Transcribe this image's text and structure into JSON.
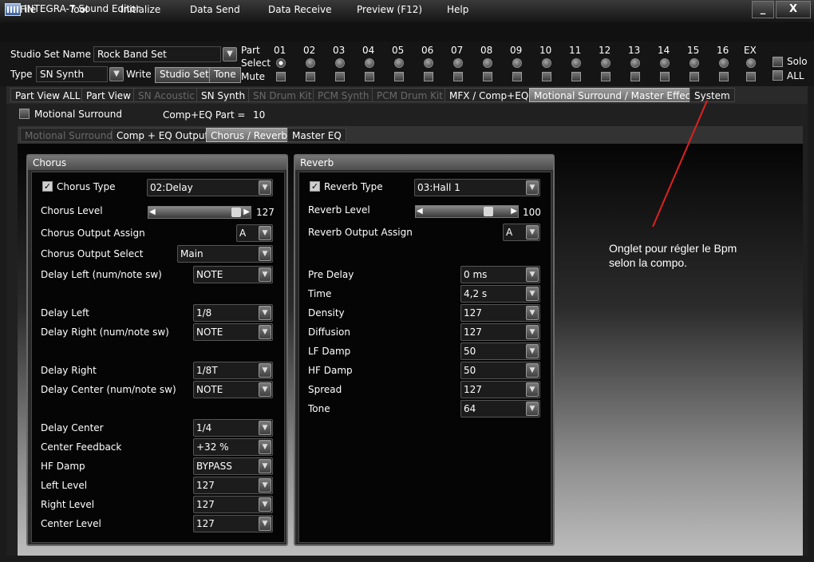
{
  "window": {
    "title": "INTEGRA-7 Sound Editor",
    "min": "_",
    "close": "X"
  },
  "menu": [
    "File",
    "Tool",
    "Initialize",
    "Data Send",
    "Data Receive",
    "Preview (F12)",
    "Help"
  ],
  "topbar": {
    "studio_set_label": "Studio Set Name",
    "studio_set_value": "Rock Band Set",
    "type_label": "Type",
    "type_value": "SN Synth",
    "write_label": "Write",
    "studio_set_btn": "Studio Set",
    "tone_btn": "Tone",
    "part_label": "Part",
    "select_label": "Select",
    "mute_label": "Mute",
    "parts": [
      "01",
      "02",
      "03",
      "04",
      "05",
      "06",
      "07",
      "08",
      "09",
      "10",
      "11",
      "12",
      "13",
      "14",
      "15",
      "16",
      "EX"
    ],
    "selected_part": "01",
    "solo_label": "Solo",
    "all_label": "ALL"
  },
  "tabs": [
    "Part View ALL",
    "Part View",
    "SN Acoustic",
    "SN Synth",
    "SN Drum Kit",
    "PCM Synth",
    "PCM Drum Kit",
    "MFX / Comp+EQ",
    "Motional Surround / Master Effects",
    "System"
  ],
  "motional": {
    "label": "Motional Surround",
    "comp_eq_label": "Comp+EQ Part =",
    "comp_eq_value": "10"
  },
  "subtabs": [
    "Motional Surround",
    "Comp + EQ Output",
    "Chorus / Reverb",
    "Master EQ"
  ],
  "chorus": {
    "title": "Chorus",
    "type_label": "Chorus Type",
    "type_value": "02:Delay",
    "level_label": "Chorus Level",
    "level_value": "127",
    "level_fraction": 1.0,
    "output_assign_label": "Chorus Output Assign",
    "output_assign_value": "A",
    "output_select_label": "Chorus Output Select",
    "output_select_value": "Main",
    "params": [
      {
        "label": "Delay Left (num/note sw)",
        "value": "NOTE"
      },
      {
        "label": "Delay Left",
        "value": "1/8"
      },
      {
        "label": "Delay Right (num/note sw)",
        "value": "NOTE"
      },
      {
        "label": "Delay Right",
        "value": "1/8T"
      },
      {
        "label": "Delay Center (num/note sw)",
        "value": "NOTE"
      },
      {
        "label": "Delay Center",
        "value": "1/4"
      },
      {
        "label": "Center Feedback",
        "value": "+32 %"
      },
      {
        "label": "HF Damp",
        "value": "BYPASS"
      },
      {
        "label": "Left Level",
        "value": "127"
      },
      {
        "label": "Right Level",
        "value": "127"
      },
      {
        "label": "Center Level",
        "value": "127"
      }
    ]
  },
  "reverb": {
    "title": "Reverb",
    "type_label": "Reverb Type",
    "type_value": "03:Hall 1",
    "level_label": "Reverb Level",
    "level_value": "100",
    "level_fraction": 0.79,
    "output_assign_label": "Reverb Output Assign",
    "output_assign_value": "A",
    "params": [
      {
        "label": "Pre Delay",
        "value": "0 ms"
      },
      {
        "label": "Time",
        "value": "4,2 s"
      },
      {
        "label": "Density",
        "value": "127"
      },
      {
        "label": "Diffusion",
        "value": "127"
      },
      {
        "label": "LF Damp",
        "value": "50"
      },
      {
        "label": "HF Damp",
        "value": "50"
      },
      {
        "label": "Spread",
        "value": "127"
      },
      {
        "label": "Tone",
        "value": "64"
      }
    ]
  },
  "annotation": {
    "line1": "Onglet pour régler le Bpm",
    "line2": "selon la compo.",
    "arrow_color": "#e02020"
  }
}
